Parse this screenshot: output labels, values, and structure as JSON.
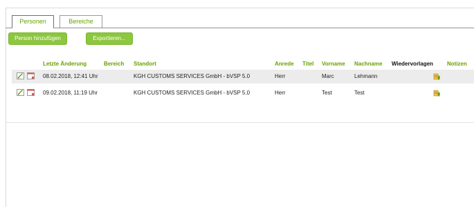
{
  "tabs": [
    {
      "label": "Personen",
      "active": true
    },
    {
      "label": "Bereiche",
      "active": false
    }
  ],
  "toolbar": {
    "add_person_label": "Person hinzufügen",
    "export_label": "Exportieren..."
  },
  "table": {
    "columns": [
      "Letzte Änderung",
      "Bereich",
      "Standort",
      "Anrede",
      "Titel",
      "Vorname",
      "Nachname",
      "Wiedervorlagen",
      "Notizen"
    ],
    "rows": [
      {
        "last_change": "08.02.2018, 12:41 Uhr",
        "area": "",
        "location": "KGH CUSTOMS SERVICES GmbH - bVSP 5.0",
        "salutation": "Herr",
        "title": "",
        "first_name": "Marc",
        "last_name": "Lehmann",
        "resubmissions": ""
      },
      {
        "last_change": "09.02.2018, 11:19 Uhr",
        "area": "",
        "location": "KGH CUSTOMS SERVICES GmbH - bVSP 5.0",
        "salutation": "Herr",
        "title": "",
        "first_name": "Test",
        "last_name": "Test",
        "resubmissions": ""
      }
    ]
  },
  "icons": {
    "edit": "edit-icon",
    "delete": "delete-icon",
    "notes": "notes-icon"
  },
  "colors": {
    "accent_green": "#8dc63f",
    "header_text_green": "#6aa000",
    "row_alt_bg": "#ececec"
  }
}
